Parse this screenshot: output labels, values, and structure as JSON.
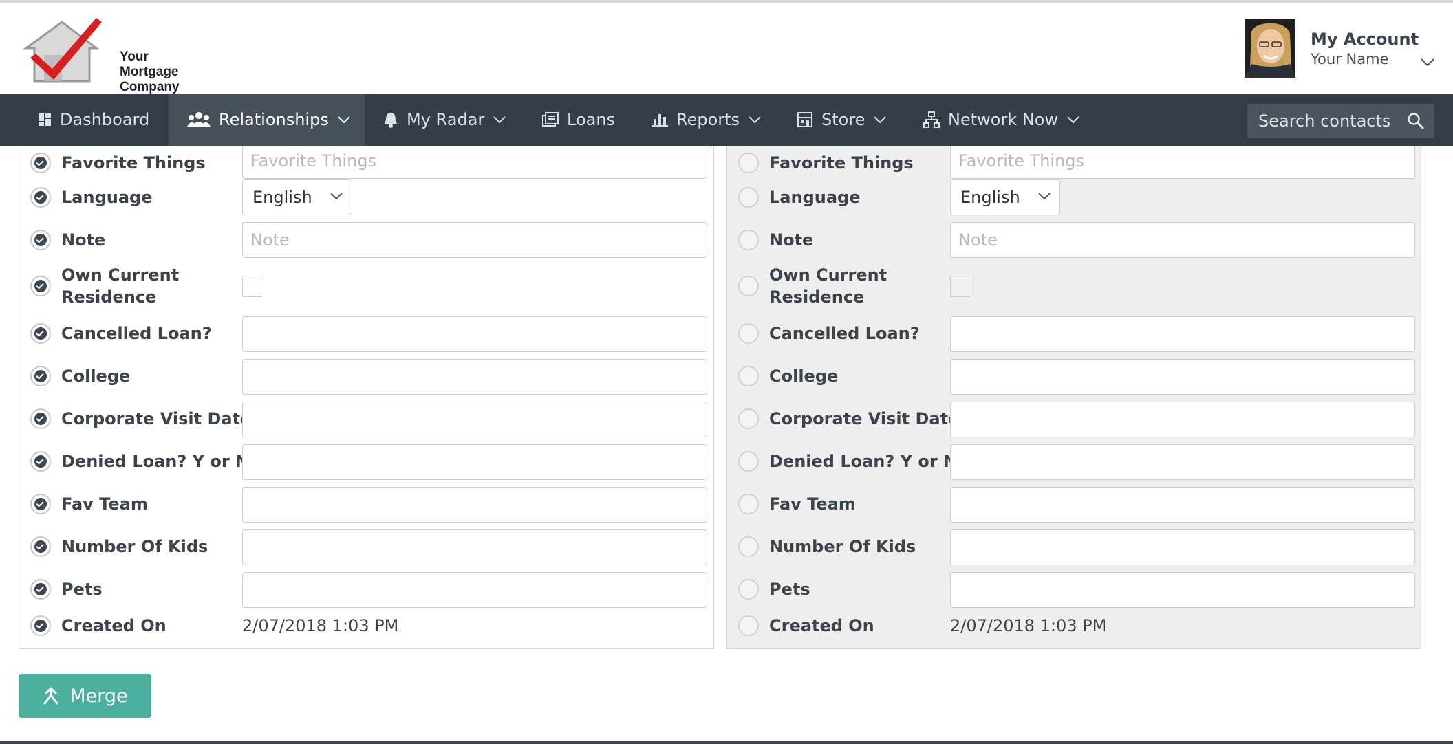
{
  "logo": {
    "line1": "Your",
    "line2": "Mortgage",
    "line3": "Company"
  },
  "account": {
    "title": "My Account",
    "name": "Your Name"
  },
  "nav": {
    "items": [
      {
        "label": "Dashboard",
        "icon": "dashboard-icon"
      },
      {
        "label": "Relationships",
        "icon": "users-icon"
      },
      {
        "label": "My Radar",
        "icon": "bell-icon"
      },
      {
        "label": "Loans",
        "icon": "loans-icon"
      },
      {
        "label": "Reports",
        "icon": "bar-chart-icon"
      },
      {
        "label": "Store",
        "icon": "store-icon"
      },
      {
        "label": "Network Now",
        "icon": "network-icon"
      }
    ],
    "search_placeholder": "Search contacts"
  },
  "fields": {
    "favorite_things": {
      "label": "Favorite Things",
      "placeholder": "Favorite Things"
    },
    "language": {
      "label": "Language",
      "value": "English"
    },
    "note": {
      "label": "Note",
      "placeholder": "Note"
    },
    "own_current_residence": {
      "label_line1": "Own Current",
      "label_line2": "Residence"
    },
    "cancelled_loan": {
      "label": "Cancelled Loan?"
    },
    "college": {
      "label": "College"
    },
    "corporate_visit_date": {
      "label": "Corporate Visit Date"
    },
    "denied_loan": {
      "label": "Denied Loan? Y or N?"
    },
    "fav_team": {
      "label": "Fav Team"
    },
    "number_of_kids": {
      "label": "Number Of Kids"
    },
    "pets": {
      "label": "Pets"
    },
    "created_on": {
      "label": "Created On",
      "value": "2/07/2018 1:03 PM"
    }
  },
  "merge_label": "Merge"
}
